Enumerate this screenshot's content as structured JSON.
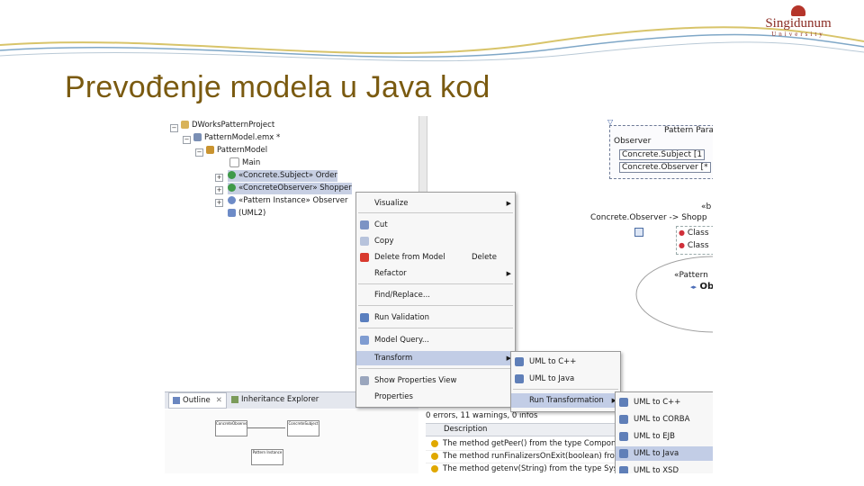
{
  "slide": {
    "title": "Prevođenje modela u Java kod",
    "logo": {
      "name": "Singidunum",
      "sub": "University"
    }
  },
  "explorer": {
    "items": [
      {
        "label": "DWorksPatternProject",
        "icon_color": "#d8b35a"
      },
      {
        "label": "PatternModel.emx *",
        "icon_color": "#7a8fb5"
      },
      {
        "label": "PatternModel",
        "icon_color": "#c9932f"
      },
      {
        "label": "Main",
        "icon_color": "#ffffff"
      },
      {
        "label": "«Concrete.Subject» Order",
        "icon_color": "#3f9a49"
      },
      {
        "label": "«ConcreteObserver» Shopper",
        "icon_color": "#3f9a49"
      },
      {
        "label": "«Pattern Instance» Observer",
        "icon_color": "#6d8bc7"
      },
      {
        "label": "(UML2)",
        "icon_color": "#6d8bc7"
      }
    ]
  },
  "context_menu": {
    "items": [
      {
        "label": "Visualize",
        "has_submenu": true
      },
      {
        "label": "Cut",
        "icon": "scissors-icon"
      },
      {
        "label": "Copy",
        "icon": "copy-icon"
      },
      {
        "label": "Delete from Model",
        "accelerator": "Delete",
        "icon": "delete-icon"
      },
      {
        "label": "Refactor",
        "has_submenu": true
      },
      {
        "label": "Find/Replace..."
      },
      {
        "label": "Run Validation",
        "icon": "validation-icon"
      },
      {
        "label": "Model Query...",
        "icon": "query-icon"
      },
      {
        "label": "Transform",
        "has_submenu": true,
        "highlighted": true
      },
      {
        "label": "Show Properties View",
        "icon": "properties-icon"
      },
      {
        "label": "Properties"
      }
    ]
  },
  "transform_submenu": {
    "items": [
      {
        "label": "UML to C++"
      },
      {
        "label": "UML to Java"
      },
      {
        "label": "Run Transformation",
        "has_submenu": true,
        "highlighted": true
      }
    ]
  },
  "run_transformation_submenu": {
    "items": [
      {
        "label": "UML to C++"
      },
      {
        "label": "UML to CORBA"
      },
      {
        "label": "UML to EJB"
      },
      {
        "label": "UML to Java",
        "highlighted": true
      },
      {
        "label": "UML to XSD"
      }
    ]
  },
  "bottom_tabs": {
    "outline": "Outline",
    "inheritance": "Inheritance Explorer"
  },
  "outline_boxes": [
    {
      "label": "ConcreteObserver"
    },
    {
      "label": "ConcreteSubject"
    },
    {
      "label": "Pattern Instance"
    }
  ],
  "problems": {
    "summary": "0 errors, 11 warnings, 0 infos",
    "column": "Description",
    "rows": [
      "The method getPeer() from the type Compon",
      "The method runFinalizersOnExit(boolean) fro",
      "The method getenv(String) from the type Sys"
    ]
  },
  "diagram": {
    "header": "Pattern Para",
    "observer": "Observer",
    "subject_row": "Concrete.Subject [1",
    "observer_row": "Concrete.Observer [*",
    "stereo_right": "«b",
    "binding": "Concrete.Observer -> Shopp",
    "class1": "Class",
    "class2": "Class",
    "pattern_label": "«Pattern",
    "ob_label": "Ob"
  }
}
